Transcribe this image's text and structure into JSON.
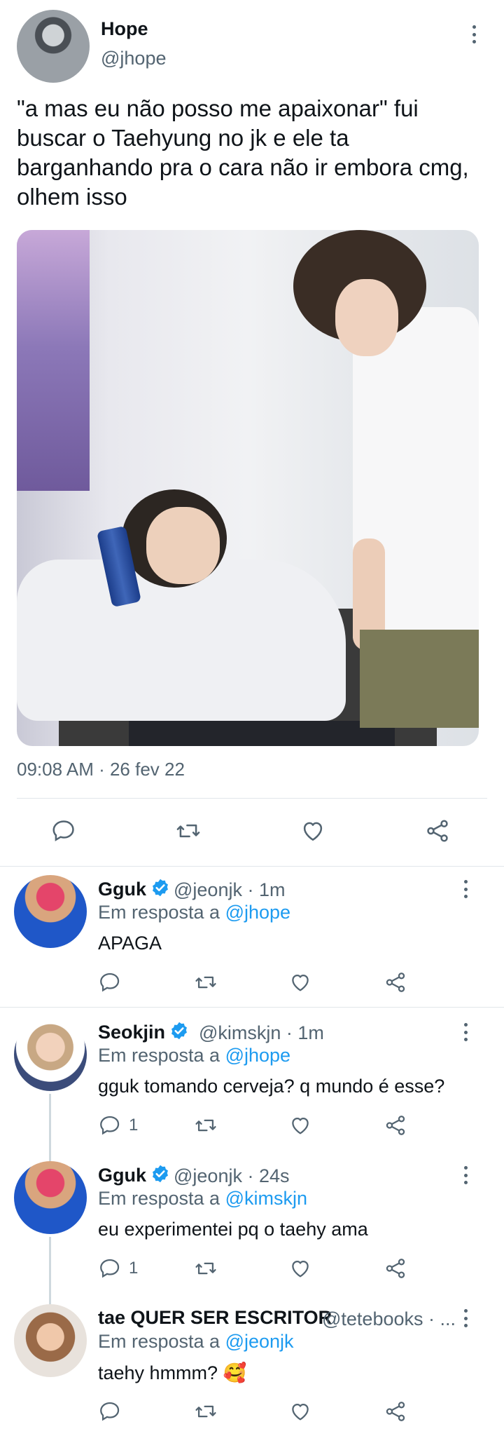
{
  "main_tweet": {
    "author_name": "Hope",
    "author_handle": "@jhope",
    "text": "\"a mas eu não posso me apaixonar\" fui buscar o Taehyung no jk e ele ta barganhando pra o cara não ir embora cmg, olhem isso",
    "timestamp": "09:08 AM · 26 fev 22",
    "actions": [
      "reply-icon",
      "retweet-icon",
      "like-icon",
      "share-icon"
    ]
  },
  "replies": [
    {
      "name": "Gguk",
      "verified": true,
      "handle_time": "@jeonjk · 1m",
      "reply_prefix": "Em resposta a ",
      "reply_to": "@jhope",
      "text": "APAGA",
      "reply_count": ""
    },
    {
      "name": "Seokjin",
      "verified": true,
      "handle_time": "@kimskjn · 1m",
      "reply_prefix": "Em resposta a ",
      "reply_to": "@jhope",
      "text": "gguk tomando cerveja? q mundo é esse?",
      "reply_count": "1"
    },
    {
      "name": "Gguk",
      "verified": true,
      "handle_time": "@jeonjk · 24s",
      "reply_prefix": "Em resposta a ",
      "reply_to": "@kimskjn",
      "text": "eu experimentei pq o taehy ama",
      "reply_count": "1"
    },
    {
      "name": "tae QUER SER ESCRITOR",
      "verified": false,
      "handle_time": "@tetebooks · ...",
      "reply_prefix": "Em resposta a ",
      "reply_to": "@jeonjk",
      "text": "taehy hmmm? 🥰",
      "reply_count": ""
    }
  ],
  "colors": {
    "accent": "#1d9bf0",
    "muted": "#536471",
    "text": "#0f1419",
    "divider": "#e1e6ea"
  }
}
